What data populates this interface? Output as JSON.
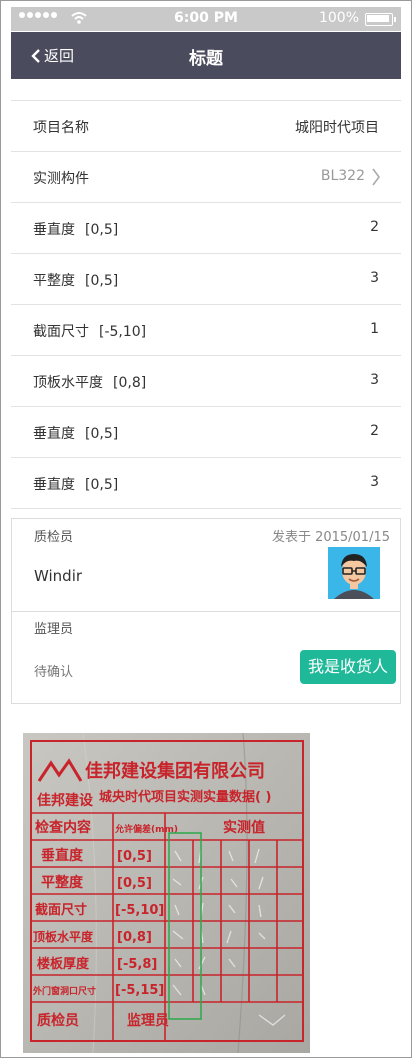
{
  "status_bar": {
    "time": "6:00 PM",
    "battery": "100%",
    "icons": [
      "signal-icon",
      "wifi-icon",
      "battery-icon"
    ]
  },
  "nav": {
    "back_label": "返回",
    "title": "标题"
  },
  "rows": [
    {
      "label": "项目名称",
      "range": "",
      "value": "城阳时代项目"
    },
    {
      "label": "实测构件",
      "range": "",
      "value": "BL322"
    },
    {
      "label": "垂直度",
      "range": "[0,5]",
      "value": "2"
    },
    {
      "label": "平整度",
      "range": "[0,5]",
      "value": "3"
    },
    {
      "label": "截面尺寸",
      "range": "[-5,10]",
      "value": "1"
    },
    {
      "label": "顶板水平度",
      "range": "[0,8]",
      "value": "3"
    },
    {
      "label": "垂直度",
      "range": "[0,5]",
      "value": "2"
    },
    {
      "label": "垂直度",
      "range": "[0,5]",
      "value": "3"
    }
  ],
  "inspector": {
    "label": "质检员",
    "posted_prefix": "发表于",
    "date": "2015/01/15",
    "name": "Windir"
  },
  "supervisor": {
    "label": "监理员",
    "status": "待确认",
    "button": "我是收货人"
  },
  "photo": {
    "company": "佳邦建设集团有限公司",
    "brand": "佳邦建设",
    "project_line": "城央时代项目实测实量数据( )",
    "header": [
      "检查内容",
      "允许偏差(mm)",
      "实测值"
    ],
    "rows": [
      {
        "item": "垂直度",
        "range": "[0,5]"
      },
      {
        "item": "平整度",
        "range": "[0,5]"
      },
      {
        "item": "截面尺寸",
        "range": "[-5,10]"
      },
      {
        "item": "顶板水平度",
        "range": "[0,8]"
      },
      {
        "item": "楼板厚度",
        "range": "[-5,8]"
      },
      {
        "item": "外门窗洞口尺寸",
        "range": "[-5,15]"
      }
    ],
    "footer": [
      "质检员",
      "监理员"
    ]
  },
  "colors": {
    "nav_bg": "#4a4b5c",
    "status_bg": "#c9c9c9",
    "accent": "#1fb99a",
    "stamp_red": "#c8242b"
  }
}
